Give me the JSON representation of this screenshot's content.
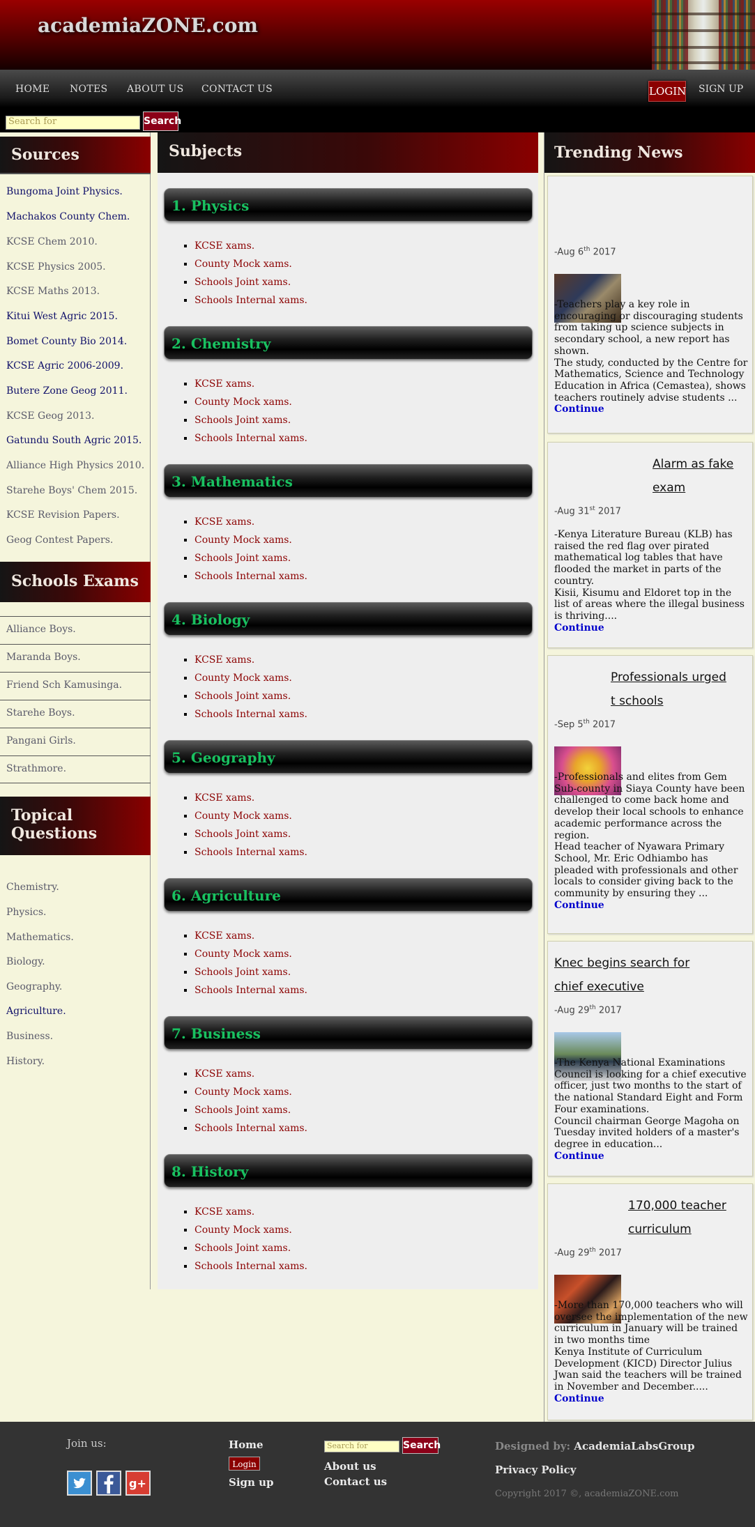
{
  "header": {
    "brand": "academiaZONE.com"
  },
  "nav": {
    "links": [
      "HOME",
      "NOTES",
      "ABOUT US",
      "CONTACT US"
    ],
    "login": "LOGIN",
    "signup": "SIGN UP",
    "search_placeholder": "Search for",
    "search_button": "Search"
  },
  "sources": {
    "title": "Sources",
    "links": [
      "Bungoma Joint Physics.",
      "Machakos County Chem.",
      "KCSE Chem 2010.",
      "KCSE Physics 2005.",
      "KCSE Maths 2013.",
      "Kitui West Agric 2015.",
      "Bomet County Bio 2014.",
      "KCSE Agric 2006-2009.",
      "Butere Zone Geog 2011.",
      "KCSE Geog 2013.",
      "Gatundu South Agric 2015.",
      "Alliance High Physics 2010.",
      "Starehe Boys' Chem 2015.",
      "KCSE Revision Papers.",
      "Geog Contest Papers."
    ]
  },
  "schools": {
    "title": "Schools Exams",
    "items": [
      "Alliance Boys.",
      "Maranda Boys.",
      "Friend Sch Kamusinga.",
      "Starehe Boys.",
      "Pangani Girls.",
      "Strathmore."
    ]
  },
  "topical": {
    "title": "Topical Questions",
    "items": [
      "Chemistry.",
      "Physics.",
      "Mathematics.",
      "Biology.",
      "Geography.",
      "Agriculture.",
      "Business.",
      "History."
    ]
  },
  "subjects": {
    "title": "Subjects",
    "items": [
      {
        "name": "1. Physics",
        "links": [
          "KCSE xams.",
          "County Mock xams.",
          "Schools Joint xams.",
          "Schools Internal xams."
        ]
      },
      {
        "name": "2. Chemistry",
        "links": [
          "KCSE xams.",
          "County Mock xams.",
          "Schools Joint xams.",
          "Schools Internal xams."
        ]
      },
      {
        "name": "3. Mathematics",
        "links": [
          "KCSE xams.",
          "County Mock xams.",
          "Schools Joint xams.",
          "Schools Internal xams."
        ]
      },
      {
        "name": "4. Biology",
        "links": [
          "KCSE xams.",
          "County Mock xams.",
          "Schools Joint xams.",
          "Schools Internal xams."
        ]
      },
      {
        "name": "5. Geography",
        "links": [
          "KCSE xams.",
          "County Mock xams.",
          "Schools Joint xams.",
          "Schools Internal xams."
        ]
      },
      {
        "name": "6. Agriculture",
        "links": [
          "KCSE xams.",
          "County Mock xams.",
          "Schools Joint xams.",
          "Schools Internal xams."
        ]
      },
      {
        "name": "7. Business",
        "links": [
          "KCSE xams.",
          "County Mock xams.",
          "Schools Joint xams.",
          "Schools Internal xams."
        ]
      },
      {
        "name": "8. History",
        "links": [
          "KCSE xams.",
          "County Mock xams.",
          "Schools Joint xams.",
          "Schools Internal xams."
        ]
      }
    ]
  },
  "trending": {
    "title": "Trending News",
    "continue": "Continue",
    "items": [
      {
        "title": "",
        "date_prefix": "-Aug 6",
        "date_suffix": "th",
        "year": "2017",
        "body_first": "-Teachers play a key role in encouraging or discouraging students from taking up science subjects in secondary school, a new report has shown.",
        "body_second": "The study, conducted by the Centre for Mathematics, Science and Technology Education in Africa (Cemastea), shows teachers routinely advise students ..."
      },
      {
        "title": "Alarm as fake exam",
        "date_prefix": "-Aug 31",
        "date_suffix": "st",
        "year": "2017",
        "body_first": "-Kenya Literature Bureau (KLB) has raised the red flag over pirated mathematical log tables that have flooded the market in parts of the country.",
        "body_second": "Kisii, Kisumu and Eldoret top in the list of areas where the illegal business is thriving...."
      },
      {
        "title": "Professionals urged t schools",
        "date_prefix": "-Sep 5",
        "date_suffix": "th",
        "year": "2017",
        "body_first": "-Professionals and elites from Gem Sub-county in Siaya County have been challenged to come back home and develop their local schools to enhance academic performance across the region.",
        "body_second": "Head teacher of Nyawara Primary School, Mr. Eric Odhiambo has pleaded with professionals and other locals to consider giving back to the community by ensuring they ..."
      },
      {
        "title": "Knec begins search for chief executive",
        "date_prefix": "-Aug 29",
        "date_suffix": "th",
        "year": "2017",
        "body_first": "-The Kenya National Examinations Council is looking for a chief executive officer, just two months to the start of the national Standard Eight and Form Four examinations.",
        "body_second": "Council chairman George Magoha on Tuesday invited holders of a master's degree in education..."
      },
      {
        "title": "170,000 teacher curriculum",
        "date_prefix": "-Aug 29",
        "date_suffix": "th",
        "year": "2017",
        "body_first": "-More than 170,000 teachers who will oversee the implementation of the new curriculum in January will be trained in two months time",
        "body_second": "Kenya Institute of Curriculum Development (KICD) Director Julius Jwan said the teachers will be trained in November and December....."
      }
    ]
  },
  "footer": {
    "join": "Join us:",
    "social": [
      "twitter",
      "facebook",
      "google-plus"
    ],
    "home": "Home",
    "login": "Login",
    "signup": "Sign up",
    "search_placeholder": "Search for",
    "search_button": "Search",
    "about": "About us",
    "contact": "Contact us",
    "designed_label": "Designed by:",
    "designed_by": "AcademiaLabsGroup",
    "privacy": "Privacy Policy",
    "copyright": "Copyright 2017 ©, academiaZONE.com"
  },
  "colors": {
    "accent": "#8b0000",
    "subject_text": "#19c160",
    "link_red": "#8b0000",
    "continue": "#0000cc"
  }
}
